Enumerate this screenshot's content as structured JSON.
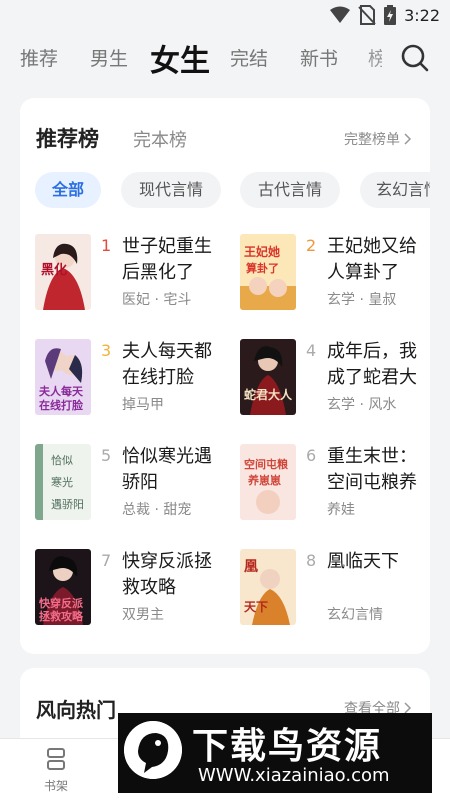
{
  "status_bar": {
    "time": "3:22",
    "icons": [
      "wifi-icon",
      "no-sim-icon",
      "battery-icon"
    ]
  },
  "top_nav": {
    "tabs": [
      {
        "label": "推荐",
        "active": false
      },
      {
        "label": "男生",
        "active": false
      },
      {
        "label": "女生",
        "active": true
      },
      {
        "label": "完结",
        "active": false
      },
      {
        "label": "新书",
        "active": false
      },
      {
        "label": "榜",
        "active": false
      }
    ],
    "search_icon": "search-icon"
  },
  "ranking": {
    "title": "推荐榜",
    "subtitle": "完本榜",
    "more_label": "完整榜单",
    "chips": [
      "全部",
      "现代言情",
      "古代言情",
      "玄幻言情"
    ],
    "books": [
      {
        "rank": "1",
        "title": "世子妃重生后黑化了",
        "tags": "医妃 · 宅斗"
      },
      {
        "rank": "2",
        "title": "王妃她又给人算卦了",
        "tags": "玄学 · 皇叔"
      },
      {
        "rank": "3",
        "title": "夫人每天都在线打脸",
        "tags": "掉马甲"
      },
      {
        "rank": "4",
        "title": "成年后，我成了蛇君大",
        "tags": "玄学 · 风水"
      },
      {
        "rank": "5",
        "title": "恰似寒光遇骄阳",
        "tags": "总裁 · 甜宠"
      },
      {
        "rank": "6",
        "title": "重生末世：空间屯粮养",
        "tags": "养娃"
      },
      {
        "rank": "7",
        "title": "快穿反派拯救攻略",
        "tags": "双男主"
      },
      {
        "rank": "8",
        "title": "凰临天下",
        "tags": "玄幻言情"
      }
    ]
  },
  "trending": {
    "title": "风向热门",
    "more_label": "查看全部"
  },
  "bottom_nav": {
    "items": [
      {
        "label": "书架",
        "icon": "bookshelf-icon"
      }
    ]
  },
  "watermark": {
    "main": "下载鸟资源",
    "url": "WWW.xiazainiao.com"
  },
  "colors": {
    "accent": "#2b6fe0",
    "rank_1": "#e34a3c",
    "rank_2": "#f0963a",
    "rank_3": "#f2b23a"
  }
}
